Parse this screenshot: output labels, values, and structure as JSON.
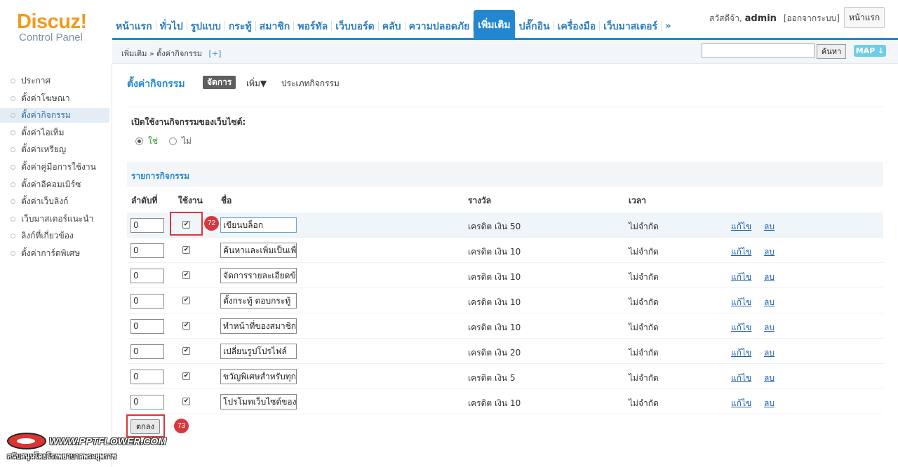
{
  "logo": {
    "brand": "Discuz!",
    "subtitle": "Control Panel"
  },
  "nav": {
    "items": [
      "หน้าแรก",
      "ทั่วไป",
      "รูปแบบ",
      "กระทู้",
      "สมาชิก",
      "พอร์ทัล",
      "เว็บบอร์ด",
      "คลับ",
      "ความปลอดภัย",
      "เพิ่มเติม",
      "ปลั๊กอิน",
      "เครื่องมือ",
      "เว็บมาสเตอร์"
    ],
    "active": "เพิ่มเติม",
    "more": "»"
  },
  "header": {
    "greeting": "สวัสดีจ้า,",
    "user": "admin",
    "logout": "[ออกจากระบบ]",
    "home_button": "หน้าแรก"
  },
  "crumb": {
    "path": "เพิ่มเติม » ตั้งค่ากิจกรรม",
    "plus": "[+]"
  },
  "search": {
    "value": "",
    "button": "ค้นหา",
    "map": "MAP ↓"
  },
  "sidebar": {
    "items": [
      "ประกาศ",
      "ตั้งค่าโฆษณา",
      "ตั้งค่ากิจกรรม",
      "ตั้งค่าไอเท็ม",
      "ตั้งค่าเหรียญ",
      "ตั้งค่าคู่มือการใช้งาน",
      "ตั้งค่าอีคอมเมิร์ซ",
      "ตั้งค่าเว็บลิงก์",
      "เว็บมาสเตอร์แนะนำ",
      "ลิงก์ที่เกี่ยวข้อง",
      "ตั้งค่าการ์ดพิเศษ"
    ],
    "active_index": 2
  },
  "main": {
    "title": "ตั้งค่ากิจกรรม",
    "tab_manage": "จัดการ",
    "tab_add": "เพิ่ม▼",
    "tab_type": "ประเภทกิจกรรม",
    "enable_label": "เปิดใช้งานกิจกรรมของเว็บไซต์:",
    "radio_yes": "ใช่",
    "radio_no": "ไม่",
    "radio_selected": "yes",
    "section_title": "รายการกิจกรรม",
    "columns": {
      "order": "ลำดับที่",
      "enabled": "ใช้งาน",
      "name": "ชื่อ",
      "reward": "รางวัล",
      "time": "เวลา"
    },
    "edit_label": "แก้ไข",
    "delete_label": "ลบ",
    "submit": "ตกลง"
  },
  "tasks": [
    {
      "order": "0",
      "enabled": true,
      "name": "เขียนบล็อก",
      "reward": "เครดิต เงิน 50",
      "time": "ไม่จำกัด"
    },
    {
      "order": "0",
      "enabled": true,
      "name": "ค้นหาและเพิ่มเป็นเพื่",
      "reward": "เครดิต เงิน 10",
      "time": "ไม่จำกัด"
    },
    {
      "order": "0",
      "enabled": true,
      "name": "จัดการรายละเอียดข้",
      "reward": "เครดิต เงิน 10",
      "time": "ไม่จำกัด"
    },
    {
      "order": "0",
      "enabled": true,
      "name": "ตั้งกระทู้ ตอบกระทู้",
      "reward": "เครดิต เงิน 10",
      "time": "ไม่จำกัด"
    },
    {
      "order": "0",
      "enabled": true,
      "name": "ทำหน้าที่ของสมาชิก",
      "reward": "เครดิต เงิน 10",
      "time": "ไม่จำกัด"
    },
    {
      "order": "0",
      "enabled": true,
      "name": "เปลี่ยนรูปโปรไฟล์",
      "reward": "เครดิต เงิน 20",
      "time": "ไม่จำกัด"
    },
    {
      "order": "0",
      "enabled": true,
      "name": "ขวัญพิเศษสำหรับทุก",
      "reward": "เครดิต เงิน 5",
      "time": "ไม่จำกัด"
    },
    {
      "order": "0",
      "enabled": true,
      "name": "โปรโมทเว็บไซต์ของ",
      "reward": "เครดิต เงิน 10",
      "time": "ไม่จำกัด"
    }
  ],
  "callouts": [
    "72",
    "73"
  ],
  "watermark": {
    "url": "WWW.PPTFLOWER.COM",
    "sub": "สนับสนุนโดยโรงพยาบาลพระยุพราช"
  },
  "colors": {
    "accent": "#2287cf",
    "callout": "#d9363e",
    "brand_orange": "#f39a1a"
  }
}
